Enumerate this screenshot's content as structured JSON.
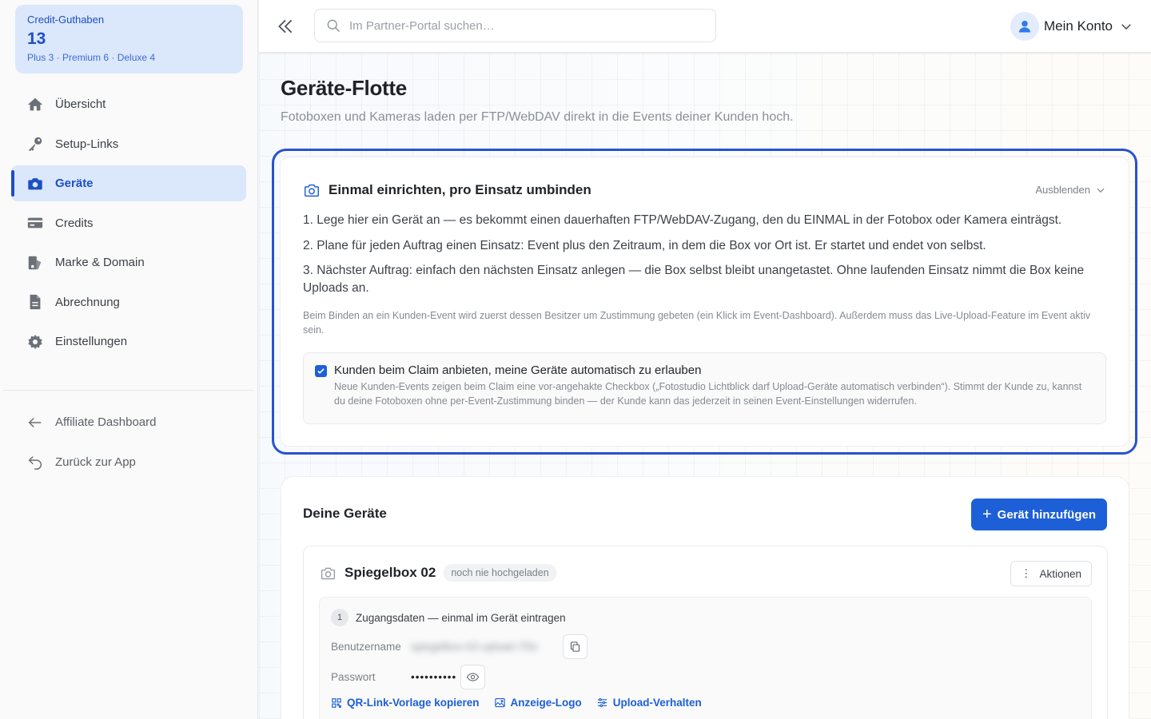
{
  "credits": {
    "label": "Credit-Guthaben",
    "value": "13",
    "breakdown": "Plus 3 · Premium 6 · Deluxe 4"
  },
  "nav": {
    "items": [
      {
        "label": "Übersicht",
        "icon": "home-icon"
      },
      {
        "label": "Setup-Links",
        "icon": "key-icon"
      },
      {
        "label": "Geräte",
        "icon": "camera-icon",
        "active": true
      },
      {
        "label": "Credits",
        "icon": "credit-card-icon"
      },
      {
        "label": "Marke & Domain",
        "icon": "brand-icon"
      },
      {
        "label": "Abrechnung",
        "icon": "document-icon"
      },
      {
        "label": "Einstellungen",
        "icon": "gear-icon"
      }
    ],
    "secondary": [
      {
        "label": "Affiliate Dashboard",
        "icon": "arrow-left-icon"
      },
      {
        "label": "Zurück zur App",
        "icon": "return-icon"
      }
    ]
  },
  "topbar": {
    "search_placeholder": "Im Partner-Portal suchen…",
    "account_label": "Mein Konto"
  },
  "page": {
    "title": "Geräte-Flotte",
    "subtitle": "Fotoboxen und Kameras laden per FTP/WebDAV direkt in die Events deiner Kunden hoch."
  },
  "info": {
    "title": "Einmal einrichten, pro Einsatz umbinden",
    "hide_label": "Ausblenden",
    "steps": [
      "1. Lege hier ein Gerät an — es bekommt einen dauerhaften FTP/WebDAV-Zugang, den du EINMAL in der Fotobox oder Kamera einträgst.",
      "2. Plane für jeden Auftrag einen Einsatz: Event plus den Zeitraum, in dem die Box vor Ort ist. Er startet und endet von selbst.",
      "3. Nächster Auftrag: einfach den nächsten Einsatz anlegen — die Box selbst bleibt unangetastet. Ohne laufenden Einsatz nimmt die Box keine Uploads an."
    ],
    "note": "Beim Binden an ein Kunden-Event wird zuerst dessen Besitzer um Zustimmung gebeten (ein Klick im Event-Dashboard). Außerdem muss das Live-Upload-Feature im Event aktiv sein.",
    "consent_title": "Kunden beim Claim anbieten, meine Geräte automatisch zu erlauben",
    "consent_desc": "Neue Kunden-Events zeigen beim Claim eine vor-angehakte Checkbox („Fotostudio Lichtblick darf Upload-Geräte automatisch verbinden“). Stimmt der Kunde zu, kannst du deine Fotoboxen ohne per-Event-Zustimmung binden — der Kunde kann das jederzeit in seinen Event-Einstellungen widerrufen.",
    "consent_checked": true
  },
  "devices": {
    "title": "Deine Geräte",
    "add_label": "Gerät hinzufügen",
    "device": {
      "name": "Spiegelbox 02",
      "status": "noch nie hochgeladen",
      "actions_label": "Aktionen",
      "step_number": "1",
      "creds_title": "Zugangsdaten — einmal im Gerät eintragen",
      "username_label": "Benutzername",
      "username_value": "spiegelbox-02-upload-7f3c",
      "password_label": "Passwort",
      "password_value": "••••••••••",
      "links": [
        "QR-Link-Vorlage kopieren",
        "Anzeige-Logo",
        "Upload-Verhalten"
      ]
    }
  },
  "colors": {
    "accent": "#1d5fd6",
    "active_nav_bg": "#dbe7fb",
    "highlight_border": "#2753d0"
  }
}
